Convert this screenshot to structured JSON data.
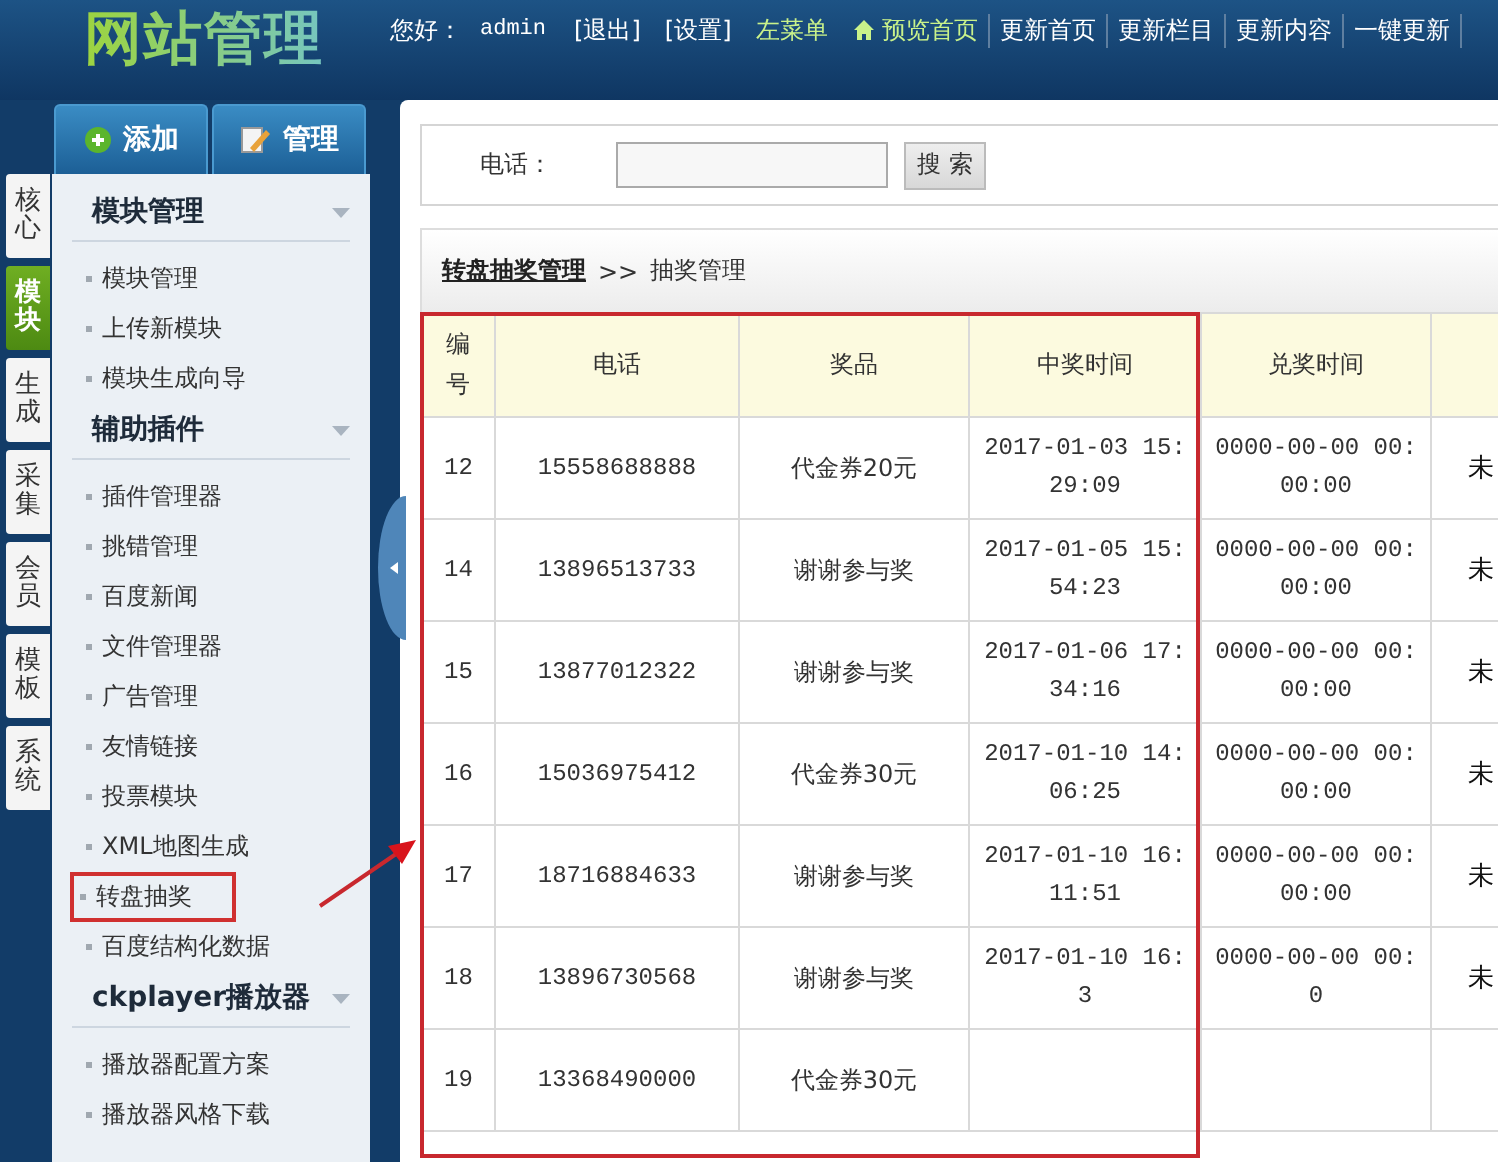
{
  "header": {
    "logo": "网站管理",
    "greeting": "您好：",
    "user": "admin",
    "links": [
      {
        "label": "[退出]",
        "kind": "link",
        "highlighted": false
      },
      {
        "label": "[设置]",
        "kind": "link",
        "highlighted": false
      },
      {
        "label": "左菜单",
        "kind": "link",
        "highlighted": true
      },
      {
        "label": "预览首页",
        "kind": "home",
        "highlighted": true
      },
      {
        "label": "更新首页",
        "kind": "menu",
        "highlighted": false
      },
      {
        "label": "更新栏目",
        "kind": "menu",
        "highlighted": false
      },
      {
        "label": "更新内容",
        "kind": "menu",
        "highlighted": false
      },
      {
        "label": "一键更新",
        "kind": "menu",
        "highlighted": false
      }
    ]
  },
  "sidebar": {
    "actions": [
      {
        "label": "添加",
        "kind": "add"
      },
      {
        "label": "管理",
        "kind": "edit"
      }
    ],
    "tabs": [
      {
        "label": "核心",
        "selected": false
      },
      {
        "label": "模块",
        "selected": true
      },
      {
        "label": "生成",
        "selected": false
      },
      {
        "label": "采集",
        "selected": false
      },
      {
        "label": "会员",
        "selected": false
      },
      {
        "label": "模板",
        "selected": false
      },
      {
        "label": "系统",
        "selected": false
      }
    ],
    "sections": [
      {
        "title": "模块管理",
        "items": [
          {
            "label": "模块管理",
            "marked": false
          },
          {
            "label": "上传新模块",
            "marked": false
          },
          {
            "label": "模块生成向导",
            "marked": false
          }
        ]
      },
      {
        "title": "辅助插件",
        "items": [
          {
            "label": "插件管理器",
            "marked": false
          },
          {
            "label": "挑错管理",
            "marked": false
          },
          {
            "label": "百度新闻",
            "marked": false
          },
          {
            "label": "文件管理器",
            "marked": false
          },
          {
            "label": "广告管理",
            "marked": false
          },
          {
            "label": "友情链接",
            "marked": false
          },
          {
            "label": "投票模块",
            "marked": false
          },
          {
            "label": "XML地图生成",
            "marked": false
          },
          {
            "label": "转盘抽奖",
            "marked": true
          },
          {
            "label": "百度结构化数据",
            "marked": false
          }
        ]
      },
      {
        "title": "ckplayer播放器",
        "items": [
          {
            "label": "播放器配置方案",
            "marked": false
          },
          {
            "label": "播放器风格下载",
            "marked": false
          }
        ]
      }
    ]
  },
  "search": {
    "label": "电话：",
    "button": "搜 索"
  },
  "breadcrumb": {
    "link": "转盘抽奖管理",
    "separator": ">>",
    "current": "抽奖管理"
  },
  "table": {
    "marked": true,
    "columns": [
      "编号",
      "电话",
      "奖品",
      "中奖时间",
      "兑奖时间"
    ],
    "rows": [
      {
        "id": "12",
        "phone": "15558688888",
        "prize": "代金券20元",
        "won_at": "2017-01-03 15:29:09",
        "redeemed_at": "0000-00-00 00:00:00",
        "status": "未"
      },
      {
        "id": "14",
        "phone": "13896513733",
        "prize": "谢谢参与奖",
        "won_at": "2017-01-05 15:54:23",
        "redeemed_at": "0000-00-00 00:00:00",
        "status": "未"
      },
      {
        "id": "15",
        "phone": "13877012322",
        "prize": "谢谢参与奖",
        "won_at": "2017-01-06 17:34:16",
        "redeemed_at": "0000-00-00 00:00:00",
        "status": "未"
      },
      {
        "id": "16",
        "phone": "15036975412",
        "prize": "代金券30元",
        "won_at": "2017-01-10 14:06:25",
        "redeemed_at": "0000-00-00 00:00:00",
        "status": "未"
      },
      {
        "id": "17",
        "phone": "18716884633",
        "prize": "谢谢参与奖",
        "won_at": "2017-01-10 16:11:51",
        "redeemed_at": "0000-00-00 00:00:00",
        "status": "未"
      },
      {
        "id": "18",
        "phone": "13896730568",
        "prize": "谢谢参与奖",
        "won_at": "2017-01-10 16:3",
        "redeemed_at": "0000-00-00 00:0",
        "status": "未"
      },
      {
        "id": "19",
        "phone": "13368490000",
        "prize": "代金券30元"
      }
    ]
  }
}
